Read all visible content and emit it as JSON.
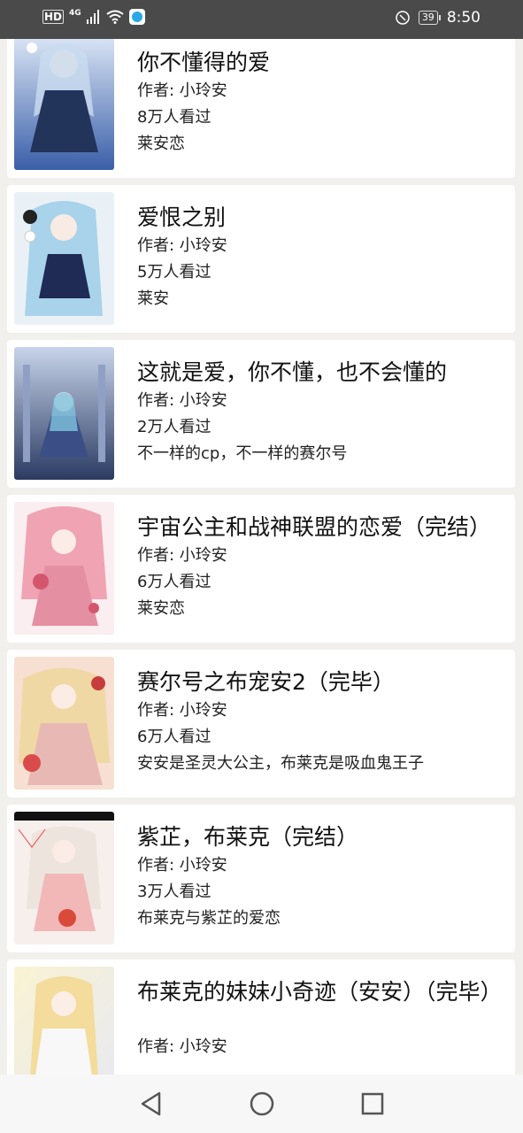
{
  "status_bar": {
    "network_badge": "HD",
    "network_type": "4G",
    "battery": "39",
    "time": "8:50"
  },
  "colors": {
    "background": "#f1f0ed",
    "card": "#ffffff",
    "status_bar": "#4a4a4a"
  },
  "books": [
    {
      "title": "你不懂得的爱",
      "author": "作者: 小玲安",
      "views": "8万人看过",
      "tag": "莱安恋",
      "cover_icon": "anime-girl-cover"
    },
    {
      "title": "爱恨之别",
      "author": "作者: 小玲安",
      "views": "5万人看过",
      "tag": "莱安",
      "cover_icon": "anime-girl-cover"
    },
    {
      "title": "这就是爱，你不懂，也不会懂的",
      "author": "作者: 小玲安",
      "views": "2万人看过",
      "tag": "不一样的cp，不一样的赛尔号",
      "cover_icon": "anime-girl-cover"
    },
    {
      "title": "宇宙公主和战神联盟的恋爱（完结）",
      "author": "作者: 小玲安",
      "views": "6万人看过",
      "tag": "莱安恋",
      "cover_icon": "anime-girl-cover"
    },
    {
      "title": "赛尔号之布宠安2（完毕）",
      "author": "作者: 小玲安",
      "views": "6万人看过",
      "tag": "安安是圣灵大公主，布莱克是吸血鬼王子",
      "cover_icon": "anime-girl-cover"
    },
    {
      "title": "紫芷，布莱克（完结）",
      "author": "作者: 小玲安",
      "views": "3万人看过",
      "tag": "布莱克与紫芷的爱恋",
      "cover_icon": "anime-girl-cover"
    },
    {
      "title": "布莱克的妹妹小奇迹（安安）（完毕）",
      "author": "作者: 小玲安",
      "views": "",
      "tag": "",
      "cover_icon": "anime-girl-cover"
    }
  ],
  "nav": {
    "back_icon": "back-triangle-icon",
    "home_icon": "home-circle-icon",
    "recents_icon": "recents-square-icon"
  }
}
